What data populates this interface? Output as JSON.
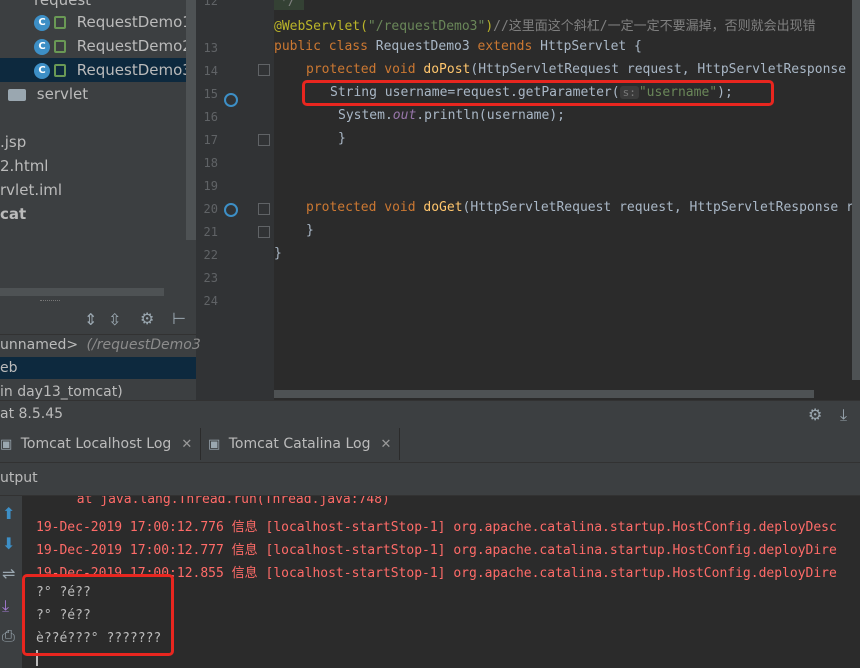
{
  "tree": {
    "top_partial": "request",
    "items": [
      {
        "label": "RequestDemo1",
        "icon": "class-icon"
      },
      {
        "label": "RequestDemo2",
        "icon": "class-icon"
      },
      {
        "label": "RequestDemo3",
        "icon": "class-icon",
        "selected": true
      }
    ],
    "servlet_folder": "servlet",
    "files": [
      ".jsp",
      "2.html",
      "rvlet.iml"
    ],
    "tomcat": "cat"
  },
  "structure": {
    "unnamed": "unnamed>",
    "path": "(/requestDemo3",
    "web": "eb",
    "in_day13": "in day13_tomcat)"
  },
  "editor": {
    "line_numbers": [
      "12",
      "13",
      "14",
      "15",
      "16",
      "17",
      "18",
      "19",
      "20",
      "21",
      "22",
      "23",
      "24"
    ],
    "lines": {
      "l12": "*/",
      "l13_ann": "@WebServlet(",
      "l13_str": "\"/requestDemo3\"",
      "l13_close": ")",
      "l13_comment": "//这里面这个斜杠/一定一定不要漏掉，否则就会出现错",
      "l14_kw": "public class ",
      "l14_name": "RequestDemo3 ",
      "l14_kw2": "extends ",
      "l14_rest": "HttpServlet {",
      "l15_kw": "protected void ",
      "l15_fn": "doPost",
      "l15_rest": "(HttpServletRequest request, HttpServletResponse",
      "l16_start": "String username=request.getParameter(",
      "l16_hint": "s:",
      "l16_str": "\"username\"",
      "l16_end": ");",
      "l17_start": "System.",
      "l17_out": "out",
      "l17_end": ".println(username);",
      "l18": "}",
      "l21_kw": "protected void ",
      "l21_fn": "doGet",
      "l21_rest": "(HttpServletRequest request, HttpServletResponse r",
      "l22": "}",
      "l23": "}"
    }
  },
  "runbar": {
    "label": "at 8.5.45"
  },
  "tabs": [
    {
      "label": "Tomcat Localhost Log"
    },
    {
      "label": "Tomcat Catalina Log"
    }
  ],
  "output_header": "utput",
  "console": {
    "line0": "       at java.lang.Thread.run(Thread.java:748)",
    "line1": "19-Dec-2019 17:00:12.776 信息 [localhost-startStop-1] org.apache.catalina.startup.HostConfig.deployDesc",
    "line2": "19-Dec-2019 17:00:12.777 信息 [localhost-startStop-1] org.apache.catalina.startup.HostConfig.deployDire",
    "line3": "19-Dec-2019 17:00:12.855 信息 [localhost-startStop-1] org.apache.catalina.startup.HostConfig.deployDire",
    "out1": "?° ?é??",
    "out2": "?° ?é??",
    "out3": "è??é???° ???????"
  },
  "colors": {
    "highlight": "#e8261f",
    "accent": "#3d8fc6"
  }
}
